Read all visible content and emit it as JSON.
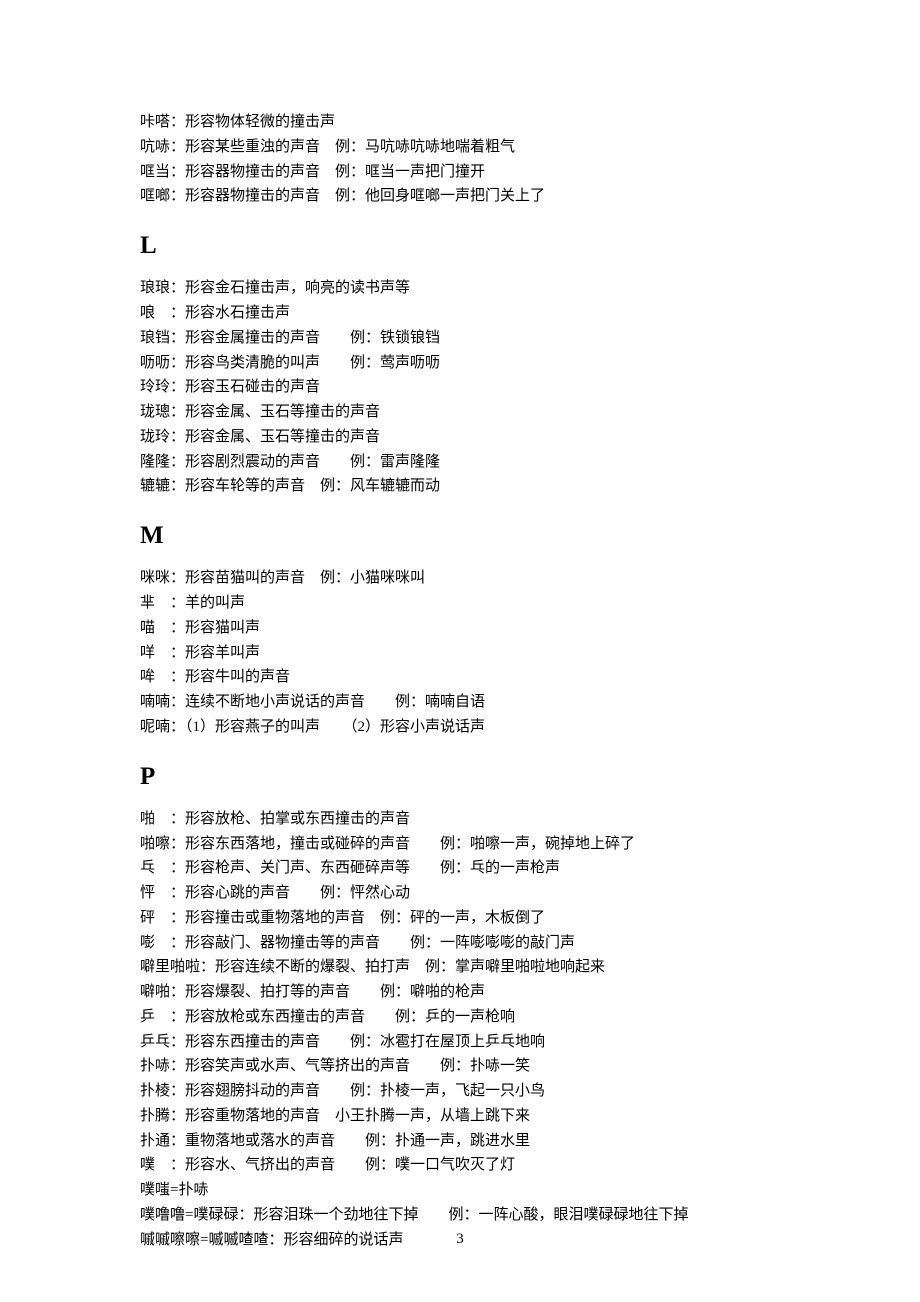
{
  "introLines": [
    "咔嗒：形容物体轻微的撞击声",
    "吭哧：形容某些重浊的声音　例：马吭哧吭哧地喘着粗气",
    "哐当：形容器物撞击的声音　例：哐当一声把门撞开",
    "哐啷：形容器物撞击的声音　例：他回身哐啷一声把门关上了"
  ],
  "sections": [
    {
      "letter": "L",
      "lines": [
        "琅琅：形容金石撞击声，响亮的读书声等",
        "哴　：形容水石撞击声",
        "琅铛：形容金属撞击的声音　　例：铁锁锒铛",
        "呖呖：形容鸟类清脆的叫声　　例：莺声呖呖",
        "玲玲：形容玉石碰击的声音",
        "珑璁：形容金属、玉石等撞击的声音",
        "珑玲：形容金属、玉石等撞击的声音",
        "隆隆：形容剧烈震动的声音　　例：雷声隆隆",
        "辘辘：形容车轮等的声音　例：风车辘辘而动"
      ]
    },
    {
      "letter": "M",
      "lines": [
        "咪咪：形容苗猫叫的声音　例：小猫咪咪叫",
        "芈　：羊的叫声",
        "喵　：形容猫叫声",
        "咩　：形容羊叫声",
        "哞　：形容牛叫的声音",
        "喃喃：连续不断地小声说话的声音　　例：喃喃自语",
        "呢喃：（1）形容燕子的叫声　　（2）形容小声说话声"
      ]
    },
    {
      "letter": "P",
      "lines": [
        "啪　：形容放枪、拍掌或东西撞击的声音",
        "啪嚓：形容东西落地，撞击或碰碎的声音　　例：啪嚓一声，碗掉地上碎了",
        "乓　：形容枪声、关门声、东西砸碎声等　　例：乓的一声枪声",
        "怦　：形容心跳的声音　　例：怦然心动",
        "砰　：形容撞击或重物落地的声音　例：砰的一声，木板倒了",
        "嘭　：形容敲门、器物撞击等的声音　　例：一阵嘭嘭嘭的敲门声",
        "噼里啪啦：形容连续不断的爆裂、拍打声　例：掌声噼里啪啦地响起来",
        "噼啪：形容爆裂、拍打等的声音　　例：噼啪的枪声",
        "乒　：形容放枪或东西撞击的声音　　例：乒的一声枪响",
        "乒乓：形容东西撞击的声音　　例：冰雹打在屋顶上乒乓地响",
        "扑哧：形容笑声或水声、气等挤出的声音　　例：扑哧一笑",
        "扑棱：形容翅膀抖动的声音　　例：扑棱一声，飞起一只小鸟",
        "扑腾：形容重物落地的声音　小王扑腾一声，从墙上跳下来",
        "扑通：重物落地或落水的声音　　例：扑通一声，跳进水里",
        "噗　：形容水、气挤出的声音　　例：噗一口气吹灭了灯",
        "噗嗤=扑哧",
        "噗噜噜=噗碌碌：形容泪珠一个劲地往下掉　　例：一阵心酸，眼泪噗碌碌地往下掉",
        "嘁嘁嚓嚓=嘁嘁喳喳：形容细碎的说话声"
      ]
    }
  ],
  "pageNumber": "3"
}
